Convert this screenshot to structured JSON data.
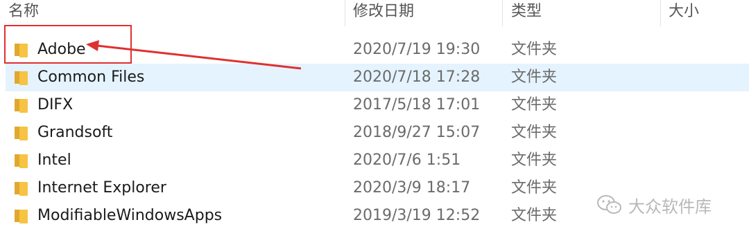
{
  "columns": {
    "name": "名称",
    "date": "修改日期",
    "type": "类型",
    "size": "大小"
  },
  "rows": [
    {
      "name": "Adobe",
      "date": "2020/7/19 19:30",
      "type": "文件夹"
    },
    {
      "name": "Common Files",
      "date": "2020/7/18 17:28",
      "type": "文件夹"
    },
    {
      "name": "DIFX",
      "date": "2017/5/18 17:01",
      "type": "文件夹"
    },
    {
      "name": "Grandsoft",
      "date": "2018/9/27 15:07",
      "type": "文件夹"
    },
    {
      "name": "Intel",
      "date": "2020/7/6 1:51",
      "type": "文件夹"
    },
    {
      "name": "Internet Explorer",
      "date": "2020/3/9 18:17",
      "type": "文件夹"
    },
    {
      "name": "ModifiableWindowsApps",
      "date": "2019/3/19 12:52",
      "type": "文件夹"
    }
  ],
  "selected_row": "Common Files",
  "annotation": {
    "color": "#e03030",
    "target_row": "Adobe"
  },
  "watermark": {
    "text": "大众软件库",
    "icon": "wechat-icon"
  },
  "colors": {
    "selection": "#e5f3ff",
    "folder": "#f6c343"
  }
}
